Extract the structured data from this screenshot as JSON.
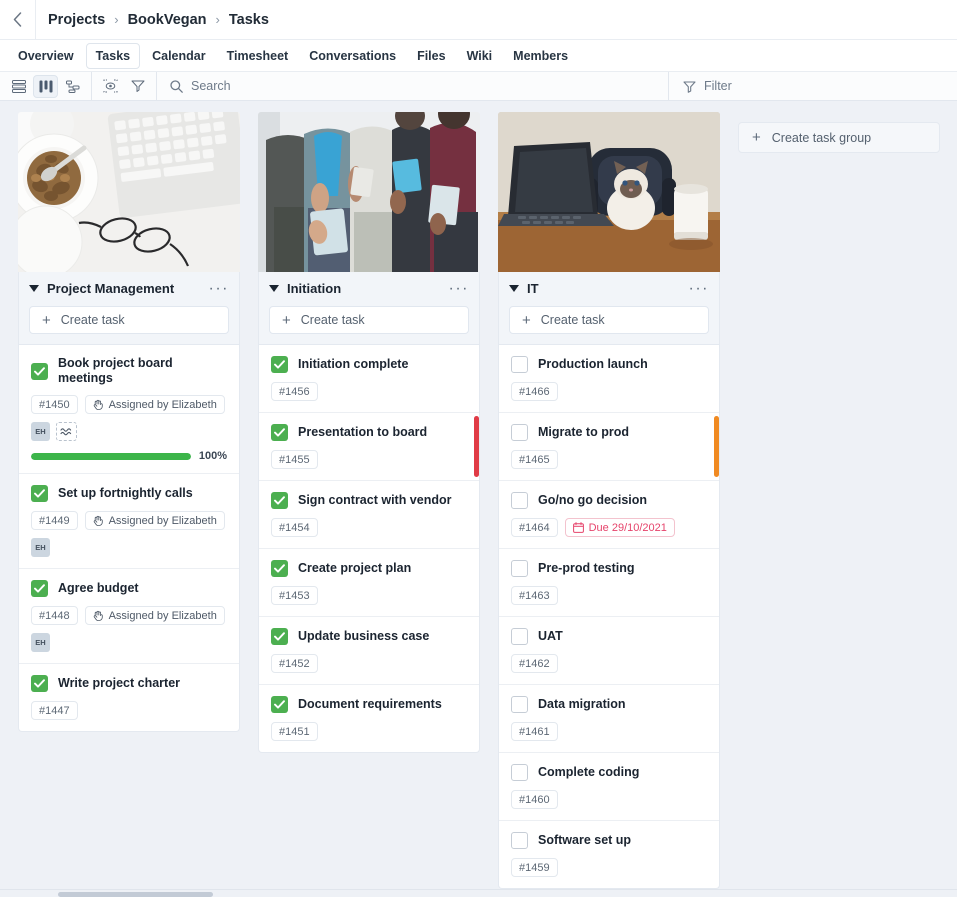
{
  "breadcrumb": {
    "back_icon": "chevron-left-icon",
    "items": [
      "Projects",
      "BookVegan",
      "Tasks"
    ],
    "separator": "›"
  },
  "tabs": [
    {
      "label": "Overview",
      "active": false
    },
    {
      "label": "Tasks",
      "active": true
    },
    {
      "label": "Calendar",
      "active": false
    },
    {
      "label": "Timesheet",
      "active": false
    },
    {
      "label": "Conversations",
      "active": false
    },
    {
      "label": "Files",
      "active": false
    },
    {
      "label": "Wiki",
      "active": false
    },
    {
      "label": "Members",
      "active": false
    }
  ],
  "toolbar": {
    "view_buttons": [
      {
        "icon": "list-view-icon",
        "active": false
      },
      {
        "icon": "board-view-icon",
        "active": true
      },
      {
        "icon": "tree-view-icon",
        "active": false
      }
    ],
    "action_buttons": [
      {
        "icon": "watch-eye-icon",
        "active": false
      },
      {
        "icon": "export-download-icon",
        "active": false
      }
    ],
    "search": {
      "icon": "search-icon",
      "placeholder": "Search",
      "value": ""
    },
    "filter": {
      "icon": "filter-icon",
      "label": "Filter"
    }
  },
  "board": {
    "create_group": {
      "icon": "plus-icon",
      "label": "Create task group"
    },
    "create_task_label": "Create task",
    "create_task_icon": "plus-icon",
    "menu_icon": "ellipsis-icon",
    "collapse_icon": "caret-down-icon",
    "columns": [
      {
        "title": "Project Management",
        "cover": "breakfast-desk-photo",
        "tasks": [
          {
            "title": "Book project board meetings",
            "checked": true,
            "id": "#1450",
            "assigned": "Assigned by Elizabeth",
            "assigned_icon": "hand-pointer-icon",
            "avatars": [
              "EH"
            ],
            "wave_icon": "recurring-icon",
            "progress": 100,
            "progress_label": "100%",
            "priority": null
          },
          {
            "title": "Set up fortnightly calls",
            "checked": true,
            "id": "#1449",
            "assigned": "Assigned by Elizabeth",
            "assigned_icon": "hand-pointer-icon",
            "avatars": [
              "EH"
            ],
            "priority": null
          },
          {
            "title": "Agree budget",
            "checked": true,
            "id": "#1448",
            "assigned": "Assigned by Elizabeth",
            "assigned_icon": "hand-pointer-icon",
            "avatars": [
              "EH"
            ],
            "priority": null
          },
          {
            "title": "Write project charter",
            "checked": true,
            "id": "#1447",
            "priority": null
          }
        ]
      },
      {
        "title": "Initiation",
        "cover": "people-standing-photo",
        "tasks": [
          {
            "title": "Initiation complete",
            "checked": true,
            "id": "#1456",
            "priority": null
          },
          {
            "title": "Presentation to board",
            "checked": true,
            "id": "#1455",
            "priority": "#e03b46"
          },
          {
            "title": "Sign contract with vendor",
            "checked": true,
            "id": "#1454",
            "priority": null
          },
          {
            "title": "Create project plan",
            "checked": true,
            "id": "#1453",
            "priority": null
          },
          {
            "title": "Update business case",
            "checked": true,
            "id": "#1452",
            "priority": null
          },
          {
            "title": "Document requirements",
            "checked": true,
            "id": "#1451",
            "priority": null
          }
        ]
      },
      {
        "title": "IT",
        "cover": "cat-laptop-photo",
        "tasks": [
          {
            "title": "Production launch",
            "checked": false,
            "id": "#1466",
            "priority": null
          },
          {
            "title": "Migrate to prod",
            "checked": false,
            "id": "#1465",
            "priority": "#f08a22"
          },
          {
            "title": "Go/no go decision",
            "checked": false,
            "id": "#1464",
            "due": "Due 29/10/2021",
            "due_icon": "calendar-icon",
            "priority": null
          },
          {
            "title": "Pre-prod testing",
            "checked": false,
            "id": "#1463",
            "priority": null
          },
          {
            "title": "UAT",
            "checked": false,
            "id": "#1462",
            "priority": null
          },
          {
            "title": "Data migration",
            "checked": false,
            "id": "#1461",
            "priority": null
          },
          {
            "title": "Complete coding",
            "checked": false,
            "id": "#1460",
            "priority": null
          },
          {
            "title": "Software set up",
            "checked": false,
            "id": "#1459",
            "priority": null
          }
        ]
      }
    ]
  },
  "colors": {
    "accent_green": "#3cb54a",
    "priority_red": "#e03b46",
    "priority_orange": "#f08a22",
    "due_red": "#e6436b",
    "board_bg": "#eef1f6"
  }
}
